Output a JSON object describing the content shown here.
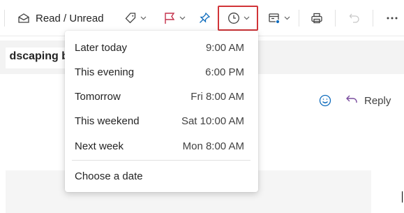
{
  "toolbar": {
    "read_unread_label": "Read / Unread"
  },
  "message": {
    "subject_fragment": "dscaping b",
    "reply_label": "Reply"
  },
  "snooze_menu": {
    "items": [
      {
        "label": "Later today",
        "time": "9:00 AM"
      },
      {
        "label": "This evening",
        "time": "6:00 PM"
      },
      {
        "label": "Tomorrow",
        "time": "Fri 8:00 AM"
      },
      {
        "label": "This weekend",
        "time": "Sat 10:00 AM"
      },
      {
        "label": "Next week",
        "time": "Mon 8:00 AM"
      }
    ],
    "choose_date_label": "Choose a date"
  },
  "colors": {
    "accent": "#0f6cbd",
    "flag": "#c4314b",
    "highlight_border": "#d13438",
    "reply_arrow": "#7a4d9e"
  }
}
